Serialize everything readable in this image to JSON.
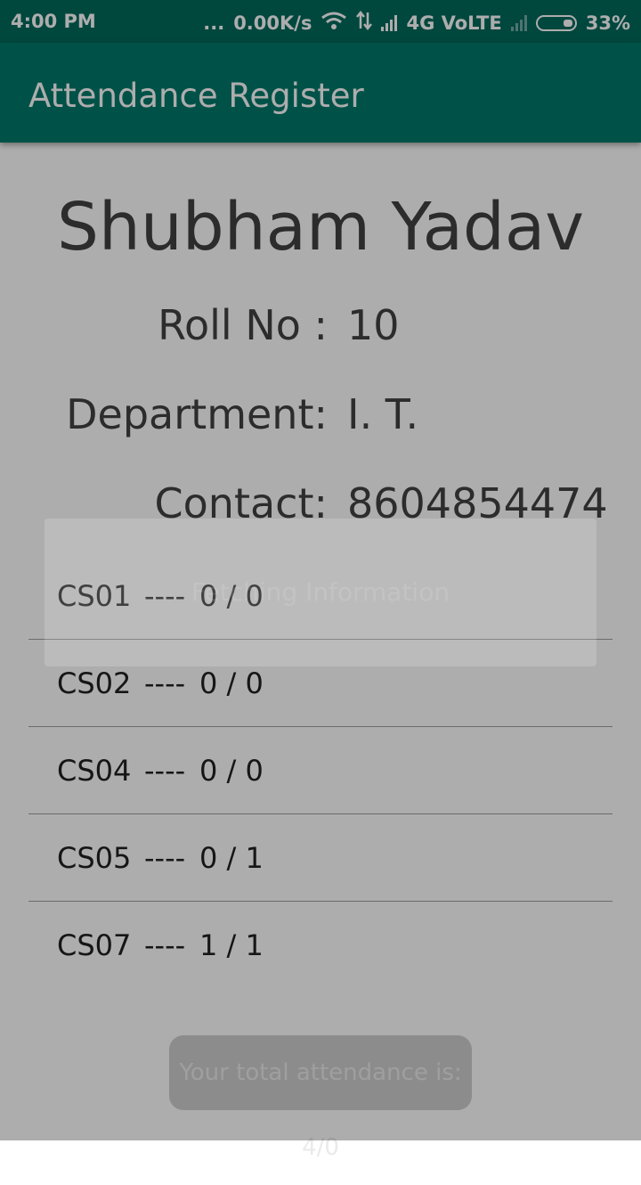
{
  "status_bar": {
    "time": "4:00 PM",
    "dots": "...",
    "speed": "0.00K/s",
    "network": "4G VoLTE",
    "battery": "33%",
    "icons": [
      "wifi-icon",
      "data-arrows-icon",
      "signal-icon",
      "no-signal-icon",
      "battery-icon"
    ]
  },
  "app_bar": {
    "title": "Attendance Register"
  },
  "student": {
    "name": "Shubham Yadav",
    "roll_label": "Roll No :",
    "roll_value": "10",
    "dept_label": "Department:",
    "dept_value": "I. T.",
    "contact_label": "Contact:",
    "contact_value": "8604854474"
  },
  "courses": [
    {
      "code": "CS01",
      "sep": "----",
      "attendance": "0 / 0"
    },
    {
      "code": "CS02",
      "sep": "----",
      "attendance": "0 / 0"
    },
    {
      "code": "CS04",
      "sep": "----",
      "attendance": "0 / 0"
    },
    {
      "code": "CS05",
      "sep": "----",
      "attendance": "0 / 1"
    },
    {
      "code": "CS07",
      "sep": "----",
      "attendance": "1 / 1"
    }
  ],
  "total_toast": "Your total attendance is: 4/0",
  "dialog": {
    "message": "Fetching Information"
  },
  "colors": {
    "status_bar": "#00695c",
    "app_bar": "#00796b"
  }
}
